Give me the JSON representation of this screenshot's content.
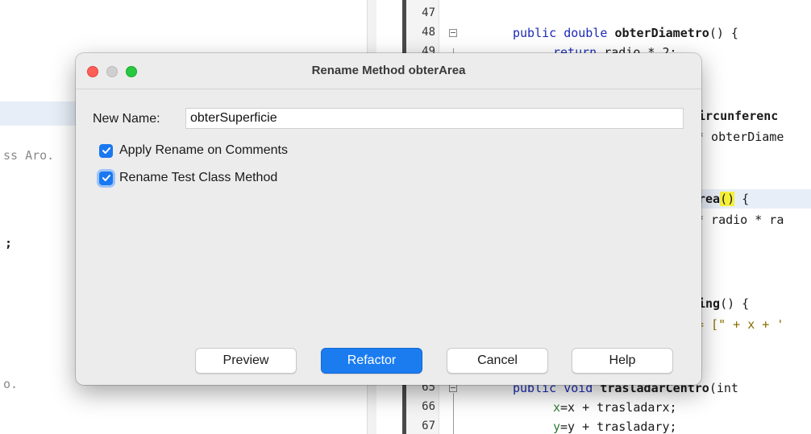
{
  "background_editor": {
    "left_fragments": [
      "ss Aro.",
      ";",
      "o."
    ],
    "line_numbers": [
      "47",
      "48",
      "49",
      "65",
      "66",
      "67"
    ],
    "code": {
      "line48": {
        "kw": "public double ",
        "name": "obterDiametro",
        "rest": "() {"
      },
      "line49": {
        "kw": "return",
        "rest": " radio * 2;"
      },
      "frag_circ": "ircunferenc",
      "frag_diam": "* obterDiame",
      "frag_area": "rea",
      "frag_area_parens": "()",
      "frag_area_brace": " {",
      "frag_radio": "* radio * ra",
      "frag_ing": "ing",
      "frag_ing_rest": "() {",
      "frag_str": "= [\" + x + '",
      "line65": {
        "kw": "public void ",
        "name": "trasladarCentro",
        "rest": "(int"
      },
      "line66": {
        "var": "x",
        "rest": "=x + trasladarx;"
      },
      "line67": {
        "var": "y",
        "rest": "=y + trasladary;"
      }
    }
  },
  "dialog": {
    "title": "Rename Method obterArea",
    "new_name_label": "New Name:",
    "new_name_value": "obterSuperficie",
    "checkboxes": [
      {
        "label": "Apply Rename on Comments",
        "checked": true
      },
      {
        "label": "Rename Test Class Method",
        "checked": true
      }
    ],
    "buttons": {
      "preview": "Preview",
      "refactor": "Refactor",
      "cancel": "Cancel",
      "help": "Help"
    }
  },
  "colors": {
    "accent": "#1b7cf0",
    "traffic_red": "#fe5f57",
    "traffic_gray": "#cfcfcf",
    "traffic_green": "#28c840",
    "keyword": "#1b2bb5",
    "highlight": "#f6f03a"
  }
}
